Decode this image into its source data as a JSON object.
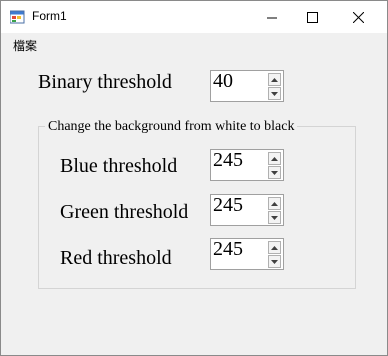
{
  "window": {
    "title": "Form1",
    "app_icon": "windows-forms-icon",
    "controls": {
      "minimize_icon": "minimize-icon",
      "maximize_icon": "maximize-icon",
      "close_icon": "close-icon"
    }
  },
  "menu": {
    "items": [
      {
        "label": "檔案"
      }
    ]
  },
  "binary": {
    "label": "Binary threshold",
    "value": "40"
  },
  "group": {
    "title": "Change the background from white to black",
    "fields": [
      {
        "label": "Blue threshold",
        "value": "245"
      },
      {
        "label": "Green threshold",
        "value": "245"
      },
      {
        "label": "Red threshold",
        "value": "245"
      }
    ]
  },
  "icons": {
    "spin_up": "spin-up-arrow-icon",
    "spin_down": "spin-down-arrow-icon"
  },
  "colors": {
    "form_background": "#f0f0f0",
    "titlebar_background": "#ffffff",
    "input_background": "#ffffff",
    "groupbox_border": "#d4d4d4"
  }
}
